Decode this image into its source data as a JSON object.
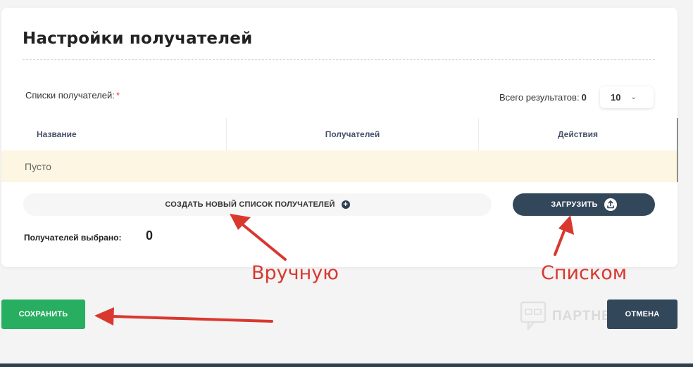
{
  "settings": {
    "title": "Настройки получателей",
    "lists_label": "Списки получателей:",
    "required_mark": "*",
    "total_label": "Всего результатов:",
    "total_value": "0",
    "per_page": "10"
  },
  "table": {
    "columns": [
      "Название",
      "Получателей",
      "Действия"
    ],
    "empty_text": "Пусто"
  },
  "actions": {
    "create_label": "СОЗДАТЬ НОВЫЙ СПИСОК ПОЛУЧАТЕЛЕЙ",
    "upload_label": "ЗАГРУЗИТЬ"
  },
  "selected": {
    "label": "Получателей выбрано:",
    "count": "0"
  },
  "footer": {
    "save_label": "СОХРАНИТЬ",
    "cancel_label": "ОТМЕНА"
  },
  "watermark": {
    "text": "ПАРТНЕР"
  },
  "annotations": {
    "manual": "Вручную",
    "by_list": "Списком"
  },
  "colors": {
    "save": "#27ae60",
    "primary_dark": "#33475b",
    "annotation": "#d9382f",
    "empty_row": "#fdf6e3"
  },
  "icons": {
    "add": "plus-circle-icon",
    "upload": "upload-icon",
    "dropdown": "chevron-down-icon"
  }
}
